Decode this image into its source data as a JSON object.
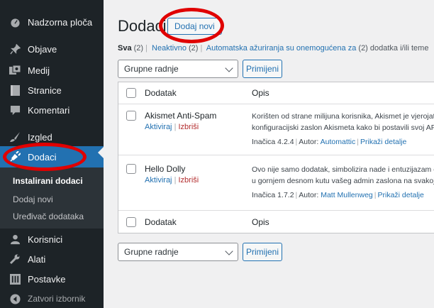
{
  "sidebar": {
    "items": [
      {
        "label": "Nadzorna ploča",
        "icon": "dashboard-icon"
      },
      {
        "label": "Objave",
        "icon": "pin-icon"
      },
      {
        "label": "Medij",
        "icon": "media-icon"
      },
      {
        "label": "Stranice",
        "icon": "page-icon"
      },
      {
        "label": "Komentari",
        "icon": "comment-icon"
      },
      {
        "label": "Izgled",
        "icon": "brush-icon"
      },
      {
        "label": "Dodaci",
        "icon": "plugin-icon"
      },
      {
        "label": "Korisnici",
        "icon": "users-icon"
      },
      {
        "label": "Alati",
        "icon": "wrench-icon"
      },
      {
        "label": "Postavke",
        "icon": "settings-icon"
      },
      {
        "label": "Zatvori izbornik",
        "icon": "collapse-icon"
      }
    ],
    "submenu": [
      "Instalirani dodaci",
      "Dodaj novi",
      "Uređivač dodataka"
    ]
  },
  "page": {
    "title": "Dodaci",
    "add_new": "Dodaj novi"
  },
  "filters": {
    "all": "Sva",
    "all_count": "(2)",
    "inactive": "Neaktivno",
    "inactive_count": "(2)",
    "auto_updates": "Automatska ažuriranja su onemogućena za",
    "auto_updates_count": "(2) dodatka i/ili teme"
  },
  "bulk": {
    "label": "Grupne radnje",
    "apply": "Primijeni"
  },
  "table": {
    "col_name": "Dodatak",
    "col_desc": "Opis",
    "plugins": [
      {
        "name": "Akismet Anti-Spam",
        "activate": "Aktiviraj",
        "delete": "Izbriši",
        "desc_line1": "Korišten od strane milijuna korisnika, Akismet je vjerojatno najbolji",
        "desc_line2": "konfiguracijski zaslon Akismeta kako bi postavili svoj API ključ.",
        "version": "Inačica 4.2.4",
        "author_label": "Autor:",
        "author": "Automattic",
        "details": "Prikaži detalje"
      },
      {
        "name": "Hello Dolly",
        "activate": "Aktiviraj",
        "delete": "Izbriši",
        "desc_line1": "Ovo nije samo dodatak, simbolizira nade i entuzijazam cijele generacije",
        "desc_line2": "u gornjem desnom kutu vašeg admin zaslona na svakoj stranici.",
        "version": "Inačica 1.7.2",
        "author_label": "Autor:",
        "author": "Matt Mullenweg",
        "details": "Prikaži detalje"
      }
    ]
  },
  "colors": {
    "sidebar_bg": "#1d2327",
    "active_bg": "#2271b1",
    "link": "#2271b1",
    "delete": "#b32d2e",
    "annotation": "#e00000"
  }
}
